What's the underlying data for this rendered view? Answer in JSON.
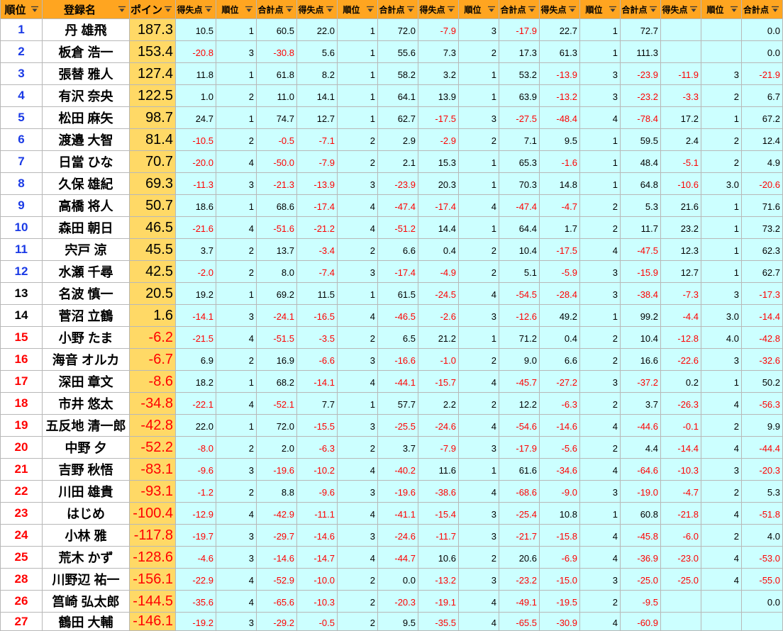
{
  "colors": {
    "header_bg": "#FFA520",
    "point_bg": "#FFD966",
    "score_bg": "#CCFFFF",
    "negative_text": "#FF0000"
  },
  "header": {
    "rank": "順位",
    "name": "登録名",
    "point": "ポイン",
    "sub": [
      "得失点",
      "順位",
      "合計点",
      "得失点",
      "順位",
      "合計点",
      "得失点",
      "順位",
      "合計点",
      "得失点",
      "順位",
      "合計点",
      "得失点",
      "順位",
      "合計点"
    ]
  },
  "rows": [
    {
      "rank": "1",
      "rank_color": "#1A3AE6",
      "name": "丹 雄飛",
      "point": "187.3",
      "scores": [
        "10.5",
        "1",
        "60.5",
        "22.0",
        "1",
        "72.0",
        "-7.9",
        "3",
        "-17.9",
        "22.7",
        "1",
        "72.7",
        null,
        null,
        "0.0"
      ]
    },
    {
      "rank": "2",
      "rank_color": "#1A3AE6",
      "name": "板倉 浩一",
      "point": "153.4",
      "scores": [
        "-20.8",
        "3",
        "-30.8",
        "5.6",
        "1",
        "55.6",
        "7.3",
        "2",
        "17.3",
        "61.3",
        "1",
        "111.3",
        null,
        null,
        "0.0"
      ]
    },
    {
      "rank": "3",
      "rank_color": "#1A3AE6",
      "name": "張替 雅人",
      "point": "127.4",
      "scores": [
        "11.8",
        "1",
        "61.8",
        "8.2",
        "1",
        "58.2",
        "3.2",
        "1",
        "53.2",
        "-13.9",
        "3",
        "-23.9",
        "-11.9",
        "3",
        "-21.9"
      ]
    },
    {
      "rank": "4",
      "rank_color": "#1A3AE6",
      "name": "有沢 奈央",
      "point": "122.5",
      "scores": [
        "1.0",
        "2",
        "11.0",
        "14.1",
        "1",
        "64.1",
        "13.9",
        "1",
        "63.9",
        "-13.2",
        "3",
        "-23.2",
        "-3.3",
        "2",
        "6.7"
      ]
    },
    {
      "rank": "5",
      "rank_color": "#1A3AE6",
      "name": "松田 麻矢",
      "point": "98.7",
      "scores": [
        "24.7",
        "1",
        "74.7",
        "12.7",
        "1",
        "62.7",
        "-17.5",
        "3",
        "-27.5",
        "-48.4",
        "4",
        "-78.4",
        "17.2",
        "1",
        "67.2"
      ]
    },
    {
      "rank": "6",
      "rank_color": "#1A3AE6",
      "name": "渡邉 大智",
      "point": "81.4",
      "scores": [
        "-10.5",
        "2",
        "-0.5",
        "-7.1",
        "2",
        "2.9",
        "-2.9",
        "2",
        "7.1",
        "9.5",
        "1",
        "59.5",
        "2.4",
        "2",
        "12.4"
      ]
    },
    {
      "rank": "7",
      "rank_color": "#1A3AE6",
      "name": "日當 ひな",
      "point": "70.7",
      "scores": [
        "-20.0",
        "4",
        "-50.0",
        "-7.9",
        "2",
        "2.1",
        "15.3",
        "1",
        "65.3",
        "-1.6",
        "1",
        "48.4",
        "-5.1",
        "2",
        "4.9"
      ]
    },
    {
      "rank": "8",
      "rank_color": "#1A3AE6",
      "name": "久保 雄紀",
      "point": "69.3",
      "scores": [
        "-11.3",
        "3",
        "-21.3",
        "-13.9",
        "3",
        "-23.9",
        "20.3",
        "1",
        "70.3",
        "14.8",
        "1",
        "64.8",
        "-10.6",
        "3.0",
        "-20.6"
      ]
    },
    {
      "rank": "9",
      "rank_color": "#1A3AE6",
      "name": "高橋 将人",
      "point": "50.7",
      "scores": [
        "18.6",
        "1",
        "68.6",
        "-17.4",
        "4",
        "-47.4",
        "-17.4",
        "4",
        "-47.4",
        "-4.7",
        "2",
        "5.3",
        "21.6",
        "1",
        "71.6"
      ]
    },
    {
      "rank": "10",
      "rank_color": "#1A3AE6",
      "name": "森田 朝日",
      "point": "46.5",
      "scores": [
        "-21.6",
        "4",
        "-51.6",
        "-21.2",
        "4",
        "-51.2",
        "14.4",
        "1",
        "64.4",
        "1.7",
        "2",
        "11.7",
        "23.2",
        "1",
        "73.2"
      ]
    },
    {
      "rank": "11",
      "rank_color": "#1A3AE6",
      "name": "宍戸 涼",
      "point": "45.5",
      "scores": [
        "3.7",
        "2",
        "13.7",
        "-3.4",
        "2",
        "6.6",
        "0.4",
        "2",
        "10.4",
        "-17.5",
        "4",
        "-47.5",
        "12.3",
        "1",
        "62.3"
      ]
    },
    {
      "rank": "12",
      "rank_color": "#1A3AE6",
      "name": "水瀬 千尋",
      "point": "42.5",
      "scores": [
        "-2.0",
        "2",
        "8.0",
        "-7.4",
        "3",
        "-17.4",
        "-4.9",
        "2",
        "5.1",
        "-5.9",
        "3",
        "-15.9",
        "12.7",
        "1",
        "62.7"
      ]
    },
    {
      "rank": "13",
      "rank_color": "#000000",
      "name": "名波 慎一",
      "point": "20.5",
      "scores": [
        "19.2",
        "1",
        "69.2",
        "11.5",
        "1",
        "61.5",
        "-24.5",
        "4",
        "-54.5",
        "-28.4",
        "3",
        "-38.4",
        "-7.3",
        "3",
        "-17.3"
      ]
    },
    {
      "rank": "14",
      "rank_color": "#000000",
      "name": "菅沼 立鶴",
      "point": "1.6",
      "scores": [
        "-14.1",
        "3",
        "-24.1",
        "-16.5",
        "4",
        "-46.5",
        "-2.6",
        "3",
        "-12.6",
        "49.2",
        "1",
        "99.2",
        "-4.4",
        "3.0",
        "-14.4"
      ]
    },
    {
      "rank": "15",
      "rank_color": "#FF0000",
      "name": "小野 たま",
      "point": "-6.2",
      "scores": [
        "-21.5",
        "4",
        "-51.5",
        "-3.5",
        "2",
        "6.5",
        "21.2",
        "1",
        "71.2",
        "0.4",
        "2",
        "10.4",
        "-12.8",
        "4.0",
        "-42.8"
      ]
    },
    {
      "rank": "16",
      "rank_color": "#FF0000",
      "name": "海音 オルカ",
      "point": "-6.7",
      "scores": [
        "6.9",
        "2",
        "16.9",
        "-6.6",
        "3",
        "-16.6",
        "-1.0",
        "2",
        "9.0",
        "6.6",
        "2",
        "16.6",
        "-22.6",
        "3",
        "-32.6"
      ]
    },
    {
      "rank": "17",
      "rank_color": "#FF0000",
      "name": "深田 章文",
      "point": "-8.6",
      "scores": [
        "18.2",
        "1",
        "68.2",
        "-14.1",
        "4",
        "-44.1",
        "-15.7",
        "4",
        "-45.7",
        "-27.2",
        "3",
        "-37.2",
        "0.2",
        "1",
        "50.2"
      ]
    },
    {
      "rank": "18",
      "rank_color": "#FF0000",
      "name": "市井 悠太",
      "point": "-34.8",
      "scores": [
        "-22.1",
        "4",
        "-52.1",
        "7.7",
        "1",
        "57.7",
        "2.2",
        "2",
        "12.2",
        "-6.3",
        "2",
        "3.7",
        "-26.3",
        "4",
        "-56.3"
      ]
    },
    {
      "rank": "19",
      "rank_color": "#FF0000",
      "name": "五反地 清一郎",
      "point": "-42.8",
      "scores": [
        "22.0",
        "1",
        "72.0",
        "-15.5",
        "3",
        "-25.5",
        "-24.6",
        "4",
        "-54.6",
        "-14.6",
        "4",
        "-44.6",
        "-0.1",
        "2",
        "9.9"
      ]
    },
    {
      "rank": "20",
      "rank_color": "#FF0000",
      "name": "中野 夕",
      "point": "-52.2",
      "scores": [
        "-8.0",
        "2",
        "2.0",
        "-6.3",
        "2",
        "3.7",
        "-7.9",
        "3",
        "-17.9",
        "-5.6",
        "2",
        "4.4",
        "-14.4",
        "4",
        "-44.4"
      ]
    },
    {
      "rank": "21",
      "rank_color": "#FF0000",
      "name": "吉野 秋悟",
      "point": "-83.1",
      "scores": [
        "-9.6",
        "3",
        "-19.6",
        "-10.2",
        "4",
        "-40.2",
        "11.6",
        "1",
        "61.6",
        "-34.6",
        "4",
        "-64.6",
        "-10.3",
        "3",
        "-20.3"
      ]
    },
    {
      "rank": "22",
      "rank_color": "#FF0000",
      "name": "川田 雄貴",
      "point": "-93.1",
      "scores": [
        "-1.2",
        "2",
        "8.8",
        "-9.6",
        "3",
        "-19.6",
        "-38.6",
        "4",
        "-68.6",
        "-9.0",
        "3",
        "-19.0",
        "-4.7",
        "2",
        "5.3"
      ]
    },
    {
      "rank": "23",
      "rank_color": "#FF0000",
      "name": "はじめ",
      "point": "-100.4",
      "scores": [
        "-12.9",
        "4",
        "-42.9",
        "-11.1",
        "4",
        "-41.1",
        "-15.4",
        "3",
        "-25.4",
        "10.8",
        "1",
        "60.8",
        "-21.8",
        "4",
        "-51.8"
      ]
    },
    {
      "rank": "24",
      "rank_color": "#FF0000",
      "name": "小林 雅",
      "point": "-117.8",
      "scores": [
        "-19.7",
        "3",
        "-29.7",
        "-14.6",
        "3",
        "-24.6",
        "-11.7",
        "3",
        "-21.7",
        "-15.8",
        "4",
        "-45.8",
        "-6.0",
        "2",
        "4.0"
      ]
    },
    {
      "rank": "25",
      "rank_color": "#FF0000",
      "name": "荒木 かず",
      "point": "-128.6",
      "scores": [
        "-4.6",
        "3",
        "-14.6",
        "-14.7",
        "4",
        "-44.7",
        "10.6",
        "2",
        "20.6",
        "-6.9",
        "4",
        "-36.9",
        "-23.0",
        "4",
        "-53.0"
      ]
    },
    {
      "rank": "28",
      "rank_color": "#FF0000",
      "name": "川野辺 祐一",
      "point": "-156.1",
      "scores": [
        "-22.9",
        "4",
        "-52.9",
        "-10.0",
        "2",
        "0.0",
        "-13.2",
        "3",
        "-23.2",
        "-15.0",
        "3",
        "-25.0",
        "-25.0",
        "4",
        "-55.0"
      ]
    },
    {
      "rank": "26",
      "rank_color": "#FF0000",
      "name": "筥崎 弘太郎",
      "point": "-144.5",
      "scores": [
        "-35.6",
        "4",
        "-65.6",
        "-10.3",
        "2",
        "-20.3",
        "-19.1",
        "4",
        "-49.1",
        "-19.5",
        "2",
        "-9.5",
        null,
        null,
        "0.0"
      ]
    },
    {
      "rank": "27",
      "rank_color": "#FF0000",
      "name": "鶴田 大輔",
      "point": "-146.1",
      "scores": [
        "-19.2",
        "3",
        "-29.2",
        "-0.5",
        "2",
        "9.5",
        "-35.5",
        "4",
        "-65.5",
        "-30.9",
        "4",
        "-60.9",
        null,
        null,
        null
      ]
    }
  ]
}
